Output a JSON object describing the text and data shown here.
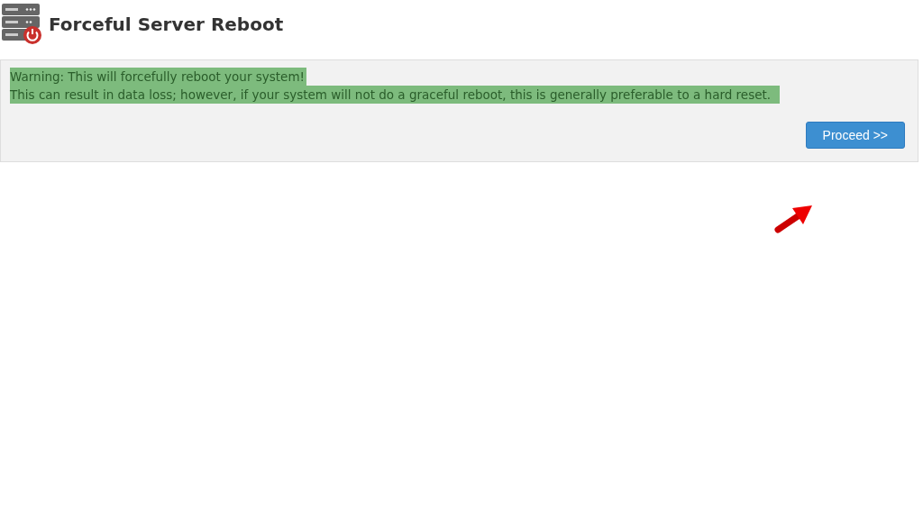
{
  "page": {
    "title": "Forceful Server Reboot"
  },
  "notice": {
    "lines": [
      "Warning: This will forcefully reboot your system!",
      "This can result in data loss; however, if your system will not do a graceful reboot, this is generally preferable to a hard reset."
    ],
    "highlighted": true
  },
  "buttons": [
    {
      "label": "Proceed >>",
      "kind": "primary"
    }
  ],
  "annotation": {
    "kind": "arrow"
  }
}
